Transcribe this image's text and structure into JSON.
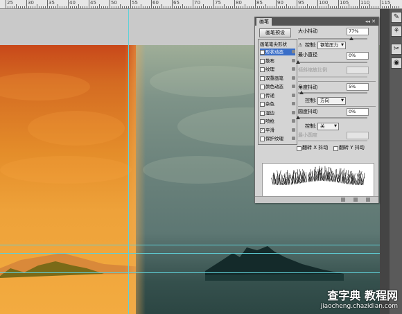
{
  "ruler": {
    "labels": [
      "25",
      "30",
      "35",
      "40",
      "45",
      "50",
      "55",
      "60",
      "65",
      "70",
      "75",
      "80",
      "85",
      "90",
      "95",
      "100",
      "105",
      "110",
      "115"
    ]
  },
  "panel": {
    "title": "画笔",
    "controls": "◂◂ ✕",
    "preset_button": "画笔预设",
    "list_header": "画笔笔尖形状",
    "items": [
      {
        "label": "形状动态",
        "checked": true,
        "selected": true
      },
      {
        "label": "散布",
        "checked": false,
        "selected": false
      },
      {
        "label": "纹理",
        "checked": false,
        "selected": false
      },
      {
        "label": "双重画笔",
        "checked": false,
        "selected": false
      },
      {
        "label": "颜色动态",
        "checked": false,
        "selected": false
      },
      {
        "label": "传递",
        "checked": false,
        "selected": false
      },
      {
        "label": "杂色",
        "checked": false,
        "selected": false
      },
      {
        "label": "湿边",
        "checked": false,
        "selected": false
      },
      {
        "label": "喷枪",
        "checked": false,
        "selected": false
      },
      {
        "label": "平滑",
        "checked": true,
        "selected": false
      },
      {
        "label": "保护纹理",
        "checked": false,
        "selected": false
      }
    ],
    "size_jitter": {
      "label": "大小抖动",
      "value": "77%",
      "level": 0.77
    },
    "control1": {
      "warn": "⚠",
      "label": "控制:",
      "value": "钢笔压力"
    },
    "min_diameter": {
      "label": "最小直径",
      "value": "0%",
      "level": 0
    },
    "tilt_scale": {
      "label": "倾斜缩放比例"
    },
    "angle_jitter": {
      "label": "角度抖动",
      "value": "5%",
      "level": 0.05
    },
    "control2": {
      "label": "控制:",
      "value": "方向"
    },
    "roundness_jitter": {
      "label": "圆度抖动",
      "value": "0%",
      "level": 0
    },
    "control3": {
      "label": "控制:",
      "value": "关"
    },
    "min_roundness": {
      "label": "最小圆度"
    },
    "flip_x": "翻转 X 抖动",
    "flip_y": "翻转 Y 抖动"
  },
  "toolstrip": {
    "icons": [
      "brush-tool-icon",
      "clone-tool-icon",
      "mask-icon",
      "layer-style-icon"
    ]
  },
  "watermark": {
    "line1": "查字典 教程网",
    "line2": "jiaocheng.chazidian.com"
  },
  "colors": {
    "guide": "#5fd0d8",
    "selection": "#3a6ec8",
    "panel_title": "#545454"
  }
}
